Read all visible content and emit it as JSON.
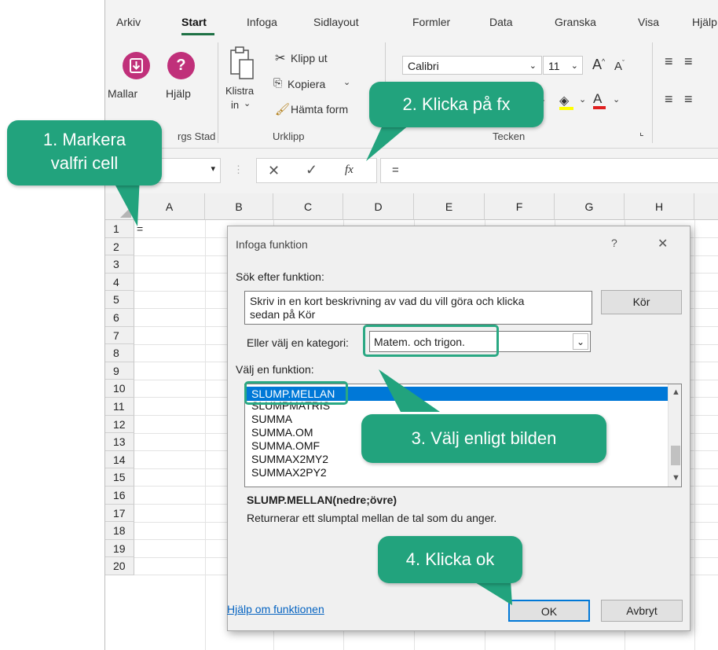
{
  "tabs": [
    "Arkiv",
    "Start",
    "Infoga",
    "Sidlayout",
    "Formler",
    "Data",
    "Granska",
    "Visa",
    "Hjälp"
  ],
  "ribbon": {
    "mallar": "Mallar",
    "hjalp": "Hjälp",
    "group_templates": "rgs Stad",
    "klistra_in": "Klistra",
    "klistra_in2": "in",
    "klipp_ut": "Klipp ut",
    "kopiera": "Kopiera",
    "hamta_format": "Hämta form",
    "group_clipboard": "Urklipp",
    "font_name": "Calibri",
    "font_size": "11",
    "group_font": "Tecken"
  },
  "formula_bar": {
    "fx": "fx",
    "content": "="
  },
  "grid": {
    "columns": [
      "A",
      "B",
      "C",
      "D",
      "E",
      "F",
      "G",
      "H"
    ],
    "rows": [
      "1",
      "2",
      "3",
      "4",
      "5",
      "6",
      "7",
      "8",
      "9",
      "10",
      "11",
      "12",
      "13",
      "14",
      "15",
      "16",
      "17",
      "18",
      "19",
      "20"
    ],
    "a1_value": "="
  },
  "dialog": {
    "title": "Infoga funktion",
    "help": "?",
    "close": "✕",
    "search_label": "Sök efter funktion:",
    "search_text_line1": "Skriv in en kort beskrivning av vad du vill göra och klicka",
    "search_text_line2": "sedan på Kör",
    "go_button": "Kör",
    "category_label": "Eller välj en kategori:",
    "category_value": "Matem. och trigon.",
    "function_label": "Välj en funktion:",
    "functions": [
      "SLUMP.MELLAN",
      "SLUMPMATRIS",
      "SUMMA",
      "SUMMA.OM",
      "SUMMA.OMF",
      "SUMMAX2MY2",
      "SUMMAX2PY2"
    ],
    "selected_function": "SLUMP.MELLAN",
    "signature": "SLUMP.MELLAN(nedre;övre)",
    "description": "Returnerar ett slumptal mellan de tal som du anger.",
    "help_link": "Hjälp om funktionen",
    "ok_button": "OK",
    "cancel_button": "Avbryt"
  },
  "callouts": {
    "step1": "1. Markera valfri cell",
    "step1_line1": "1. Markera",
    "step1_line2": "valfri cell",
    "step2": "2. Klicka på fx",
    "step3": "3. Välj enligt bilden",
    "step4": "4. Klicka ok"
  },
  "colors": {
    "accent_green": "#22a37d",
    "excel_green": "#1e7145",
    "selection_blue": "#0078d7",
    "help_pink": "#c0307a"
  }
}
